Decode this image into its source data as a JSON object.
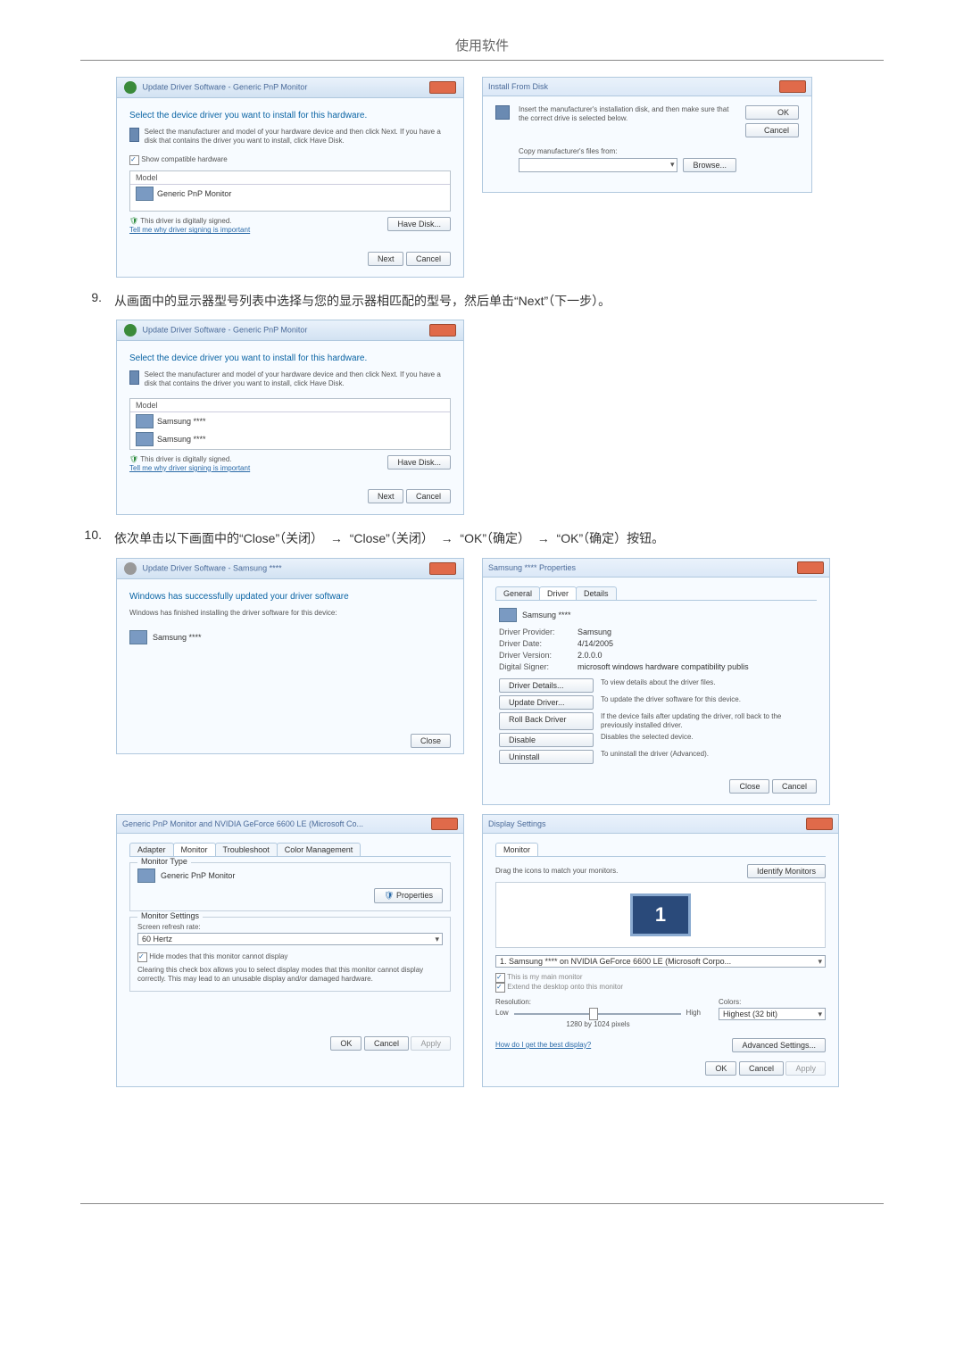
{
  "page_header": "使用软件",
  "arrow": "→",
  "dlg1": {
    "nav": "Update Driver Software - Generic PnP Monitor",
    "heading": "Select the device driver you want to install for this hardware.",
    "instr": "Select the manufacturer and model of your hardware device and then click Next. If you have a disk that contains the driver you want to install, click Have Disk.",
    "show_compat": "Show compatible hardware",
    "model_hdr": "Model",
    "model_item": "Generic PnP Monitor",
    "signed": "This driver is digitally signed.",
    "tell_link": "Tell me why driver signing is important",
    "have_disk": "Have Disk...",
    "next": "Next",
    "cancel": "Cancel"
  },
  "dlg_install": {
    "title": "Install From Disk",
    "instr": "Insert the manufacturer's installation disk, and then make sure that the correct drive is selected below.",
    "ok": "OK",
    "cancel": "Cancel",
    "copy_lbl": "Copy manufacturer's files from:",
    "browse": "Browse..."
  },
  "step9": {
    "num": "9.",
    "text_before": "从画面中的显示器型号列表中选择与您的显示器相匹配的型号，然后单击“",
    "next_word": "Next",
    "text_after": "”（下一步）。"
  },
  "dlg2": {
    "nav": "Update Driver Software - Generic PnP Monitor",
    "heading": "Select the device driver you want to install for this hardware.",
    "instr": "Select the manufacturer and model of your hardware device and then click Next. If you have a disk that contains the driver you want to install, click Have Disk.",
    "model_hdr": "Model",
    "model_item1": "Samsung ****",
    "model_item2": "Samsung ****",
    "signed": "This driver is digitally signed.",
    "tell_link": "Tell me why driver signing is important",
    "have_disk": "Have Disk...",
    "next": "Next",
    "cancel": "Cancel"
  },
  "step10": {
    "num": "10.",
    "p1": "依次单击以下画面中的“",
    "close1": "Close",
    "p2": "”（关闭）",
    "p3": "“",
    "close2": "Close",
    "p4": "”（关闭）",
    "p5": "“",
    "ok1": "OK",
    "p6": "”（确定）",
    "p7": "“",
    "ok2": "OK",
    "p8": "”（确定）按钮。"
  },
  "dlg3": {
    "nav": "Update Driver Software - Samsung ****",
    "heading": "Windows has successfully updated your driver software",
    "sub": "Windows has finished installing the driver software for this device:",
    "device": "Samsung ****",
    "close": "Close"
  },
  "dlg_prop": {
    "title": "Samsung **** Properties",
    "tab_general": "General",
    "tab_driver": "Driver",
    "tab_details": "Details",
    "dev_name": "Samsung ****",
    "provider_lbl": "Driver Provider:",
    "provider_val": "Samsung",
    "date_lbl": "Driver Date:",
    "date_val": "4/14/2005",
    "ver_lbl": "Driver Version:",
    "ver_val": "2.0.0.0",
    "signer_lbl": "Digital Signer:",
    "signer_val": "microsoft windows hardware compatibility publis",
    "btn_details": "Driver Details...",
    "txt_details": "To view details about the driver files.",
    "btn_update": "Update Driver...",
    "txt_update": "To update the driver software for this device.",
    "btn_rollback": "Roll Back Driver",
    "txt_rollback": "If the device fails after updating the driver, roll back to the previously installed driver.",
    "btn_disable": "Disable",
    "txt_disable": "Disables the selected device.",
    "btn_uninstall": "Uninstall",
    "txt_uninstall": "To uninstall the driver (Advanced).",
    "close": "Close",
    "cancel": "Cancel"
  },
  "dlg_adapter": {
    "title": "Generic PnP Monitor and NVIDIA GeForce 6600 LE (Microsoft Co...",
    "tab_adapter": "Adapter",
    "tab_monitor": "Monitor",
    "tab_trouble": "Troubleshoot",
    "tab_color": "Color Management",
    "mtype_legend": "Monitor Type",
    "mtype_val": "Generic PnP Monitor",
    "properties": "Properties",
    "mset_legend": "Monitor Settings",
    "refresh_lbl": "Screen refresh rate:",
    "refresh_val": "60 Hertz",
    "hide_chk": "Hide modes that this monitor cannot display",
    "hide_txt": "Clearing this check box allows you to select display modes that this monitor cannot display correctly. This may lead to an unusable display and/or damaged hardware.",
    "ok": "OK",
    "cancel": "Cancel",
    "apply": "Apply"
  },
  "dlg_disp": {
    "title": "Display Settings",
    "tab_monitor": "Monitor",
    "drag": "Drag the icons to match your monitors.",
    "identify": "Identify Monitors",
    "mon_sel": "1. Samsung **** on NVIDIA GeForce 6600 LE (Microsoft Corpo...",
    "ismain": "This is my main monitor",
    "extend": "Extend the desktop onto this monitor",
    "res_lbl": "Resolution:",
    "low": "Low",
    "high": "High",
    "res_val": "1280 by 1024 pixels",
    "colors_lbl": "Colors:",
    "colors_val": "Highest (32 bit)",
    "best_link": "How do I get the best display?",
    "adv": "Advanced Settings...",
    "ok": "OK",
    "cancel": "Cancel",
    "apply": "Apply"
  }
}
